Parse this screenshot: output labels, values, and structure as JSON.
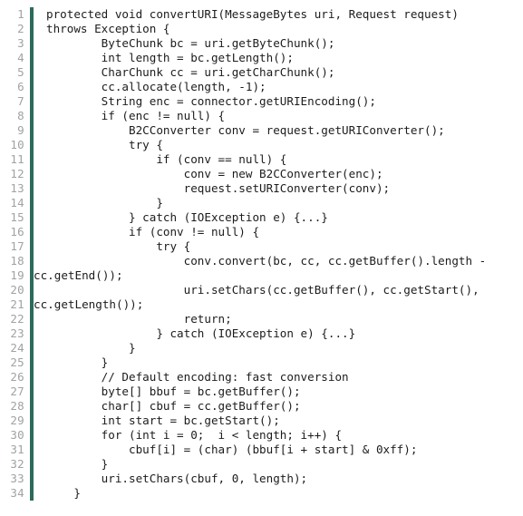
{
  "viewer": {
    "title": "Java source code listing",
    "language": "Java",
    "total_lines": 34,
    "colors": {
      "background": "#ffffff",
      "gutter_text": "#a0a3a2",
      "gutter_divider": "#2c6b5b",
      "code_text": "#1c1c1c"
    }
  },
  "lines": [
    {
      "number": "1",
      "text": "protected void convertURI(MessageBytes uri, Request request)",
      "wrapped": false
    },
    {
      "number": "2",
      "text": "throws Exception {",
      "wrapped": false
    },
    {
      "number": "3",
      "text": "        ByteChunk bc = uri.getByteChunk();",
      "wrapped": false
    },
    {
      "number": "4",
      "text": "        int length = bc.getLength();",
      "wrapped": false
    },
    {
      "number": "5",
      "text": "        CharChunk cc = uri.getCharChunk();",
      "wrapped": false
    },
    {
      "number": "6",
      "text": "        cc.allocate(length, -1);",
      "wrapped": false
    },
    {
      "number": "7",
      "text": "        String enc = connector.getURIEncoding();",
      "wrapped": false
    },
    {
      "number": "8",
      "text": "        if (enc != null) {",
      "wrapped": false
    },
    {
      "number": "9",
      "text": "            B2CConverter conv = request.getURIConverter();",
      "wrapped": false
    },
    {
      "number": "10",
      "text": "            try {",
      "wrapped": false
    },
    {
      "number": "11",
      "text": "                if (conv == null) {",
      "wrapped": false
    },
    {
      "number": "12",
      "text": "                    conv = new B2CConverter(enc);",
      "wrapped": false
    },
    {
      "number": "13",
      "text": "                    request.setURIConverter(conv);",
      "wrapped": false
    },
    {
      "number": "14",
      "text": "                }",
      "wrapped": false
    },
    {
      "number": "15",
      "text": "            } catch (IOException e) {...}",
      "wrapped": false
    },
    {
      "number": "16",
      "text": "            if (conv != null) {",
      "wrapped": false
    },
    {
      "number": "17",
      "text": "                try {",
      "wrapped": false
    },
    {
      "number": "18",
      "text": "                    conv.convert(bc, cc, cc.getBuffer().length -",
      "wrapped": false
    },
    {
      "number": "19",
      "text": "cc.getEnd());",
      "wrapped": true
    },
    {
      "number": "20",
      "text": "                    uri.setChars(cc.getBuffer(), cc.getStart(),",
      "wrapped": false
    },
    {
      "number": "21",
      "text": "cc.getLength());",
      "wrapped": true
    },
    {
      "number": "22",
      "text": "                    return;",
      "wrapped": false
    },
    {
      "number": "23",
      "text": "                } catch (IOException e) {...}",
      "wrapped": false
    },
    {
      "number": "24",
      "text": "            }",
      "wrapped": false
    },
    {
      "number": "25",
      "text": "        }",
      "wrapped": false
    },
    {
      "number": "26",
      "text": "        // Default encoding: fast conversion",
      "wrapped": false
    },
    {
      "number": "27",
      "text": "        byte[] bbuf = bc.getBuffer();",
      "wrapped": false
    },
    {
      "number": "28",
      "text": "        char[] cbuf = cc.getBuffer();",
      "wrapped": false
    },
    {
      "number": "29",
      "text": "        int start = bc.getStart();",
      "wrapped": false
    },
    {
      "number": "30",
      "text": "        for (int i = 0;  i < length; i++) {",
      "wrapped": false
    },
    {
      "number": "31",
      "text": "            cbuf[i] = (char) (bbuf[i + start] & 0xff);",
      "wrapped": false
    },
    {
      "number": "32",
      "text": "        }",
      "wrapped": false
    },
    {
      "number": "33",
      "text": "        uri.setChars(cbuf, 0, length);",
      "wrapped": false
    },
    {
      "number": "34",
      "text": "    }",
      "wrapped": false
    }
  ]
}
